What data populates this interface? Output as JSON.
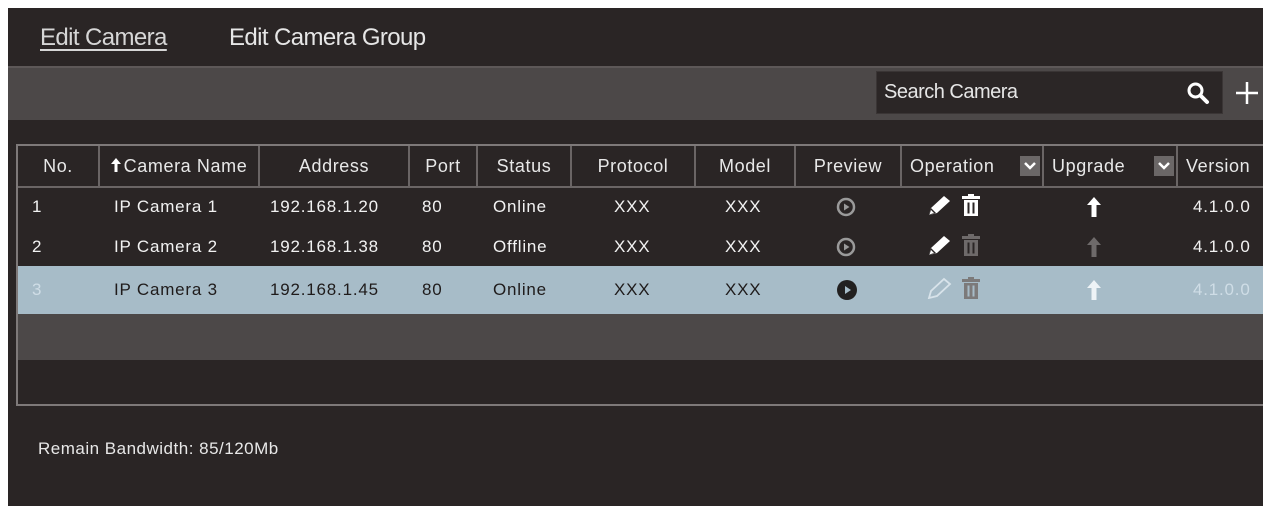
{
  "tabs": [
    {
      "label": "Edit Camera",
      "active": true
    },
    {
      "label": "Edit Camera Group",
      "active": false
    }
  ],
  "search": {
    "placeholder": "Search Camera",
    "value": ""
  },
  "columns": [
    "No.",
    "Camera Name",
    "Address",
    "Port",
    "Status",
    "Protocol",
    "Model",
    "Preview",
    "Operation",
    "Upgrade",
    "Version"
  ],
  "rows": [
    {
      "no": "1",
      "name": "IP Camera 1",
      "address": "192.168.1.20",
      "port": "80",
      "status": "Online",
      "protocol": "XXX",
      "model": "XXX",
      "version": "4.1.0.0",
      "selected": false
    },
    {
      "no": "2",
      "name": "IP Camera 2",
      "address": "192.168.1.38",
      "port": "80",
      "status": "Offline",
      "protocol": "XXX",
      "model": "XXX",
      "version": "4.1.0.0",
      "selected": false
    },
    {
      "no": "3",
      "name": "IP Camera 3",
      "address": "192.168.1.45",
      "port": "80",
      "status": "Online",
      "protocol": "XXX",
      "model": "XXX",
      "version": "4.1.0.0",
      "selected": true
    }
  ],
  "footer": {
    "remain_bandwidth": "Remain Bandwidth: 85/120Mb"
  },
  "icons": {
    "search": "search-icon",
    "add": "plus-icon",
    "sort": "sort-arrow-up-icon",
    "dropdown": "chevron-down-icon",
    "preview": "play-circle-icon",
    "edit": "pencil-icon",
    "delete": "trash-icon",
    "upgrade": "arrow-up-icon"
  },
  "colors": {
    "panel_bg": "#2a2525",
    "toolbar_bg": "#4c4848",
    "selected_row_bg": "#a7bcc8",
    "border": "#7e7979",
    "text": "#f2f2f2"
  }
}
